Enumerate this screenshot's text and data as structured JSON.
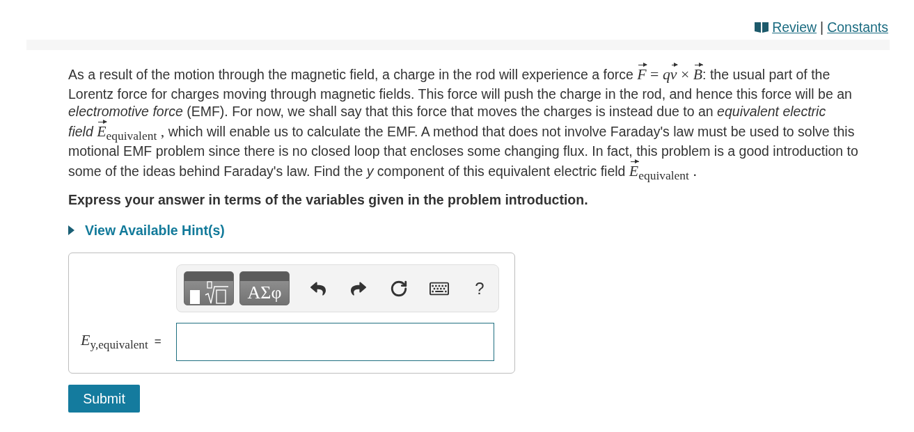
{
  "header": {
    "links": [
      {
        "label": "Review",
        "kind": "book"
      },
      {
        "label": "Constants",
        "kind": "plain"
      }
    ],
    "separator": "|"
  },
  "problem": {
    "segments": [
      {
        "kind": "text",
        "text": "As a result of the motion through the magnetic field, a charge in the rod will experience a force "
      },
      {
        "kind": "math",
        "text": "*F⃗* = *qv⃗* × *B⃗*"
      },
      {
        "kind": "text",
        "text": ": the usual part of the Lorentz force for charges moving through magnetic fields. This force will push the charge in the rod, and hence this force will be an *electromotive force* (EMF). For now, we shall say that this force that moves the charges is instead due to an *equivalent electric field* "
      },
      {
        "kind": "math",
        "text": "*E⃗*$_{equivalent}$ ,"
      },
      {
        "kind": "text",
        "text": " which will enable us to calculate the EMF. A method that does not involve Faraday's law must be used to solve this motional EMF problem since there is no closed loop that encloses some changing flux. In fact, this problem is a good introduction to some of the ideas behind Faraday's law. Find the *y* component of this equivalent electric field "
      },
      {
        "kind": "math",
        "text": "*E⃗*$_{equivalent}$ ."
      }
    ]
  },
  "instruction": "Express your answer in terms of the variables given in the problem introduction.",
  "hint_toggle": {
    "label": "View Available Hint(s)",
    "expanded": false
  },
  "answer": {
    "toolbar": [
      {
        "kind": "templates"
      },
      {
        "kind": "greek",
        "label": "ΑΣφ"
      },
      {
        "kind": "undo"
      },
      {
        "kind": "redo"
      },
      {
        "kind": "reset"
      },
      {
        "kind": "keyboard"
      },
      {
        "kind": "help",
        "label": "?"
      }
    ],
    "label": "*E*$_{y,equivalent}$",
    "equals": "="
  },
  "submit": {
    "label": "Submit"
  }
}
